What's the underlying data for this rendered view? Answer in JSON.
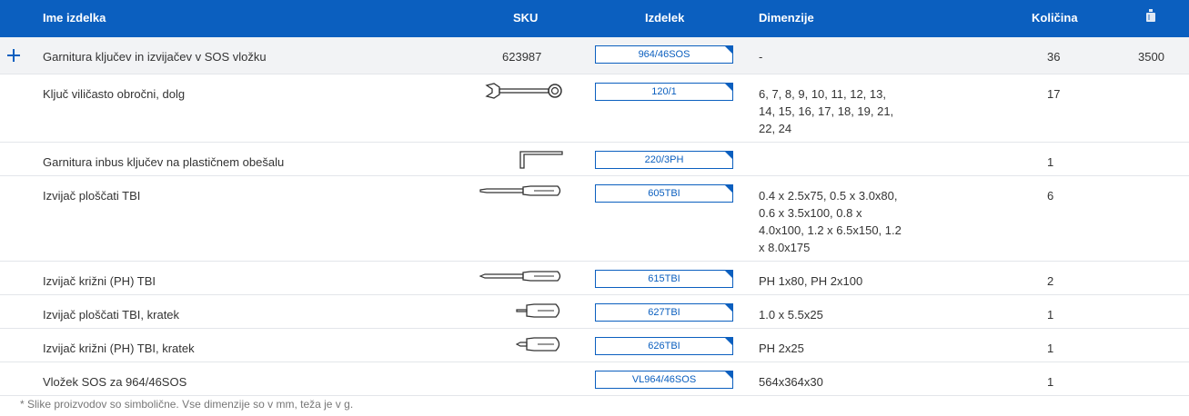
{
  "header": {
    "name": "Ime izdelka",
    "sku": "SKU",
    "product": "Izdelek",
    "dimensions": "Dimenzije",
    "quantity": "Količina",
    "weight_icon": "weight-icon"
  },
  "rows": [
    {
      "name": "Garnitura ključev in izvijačev v SOS vložku",
      "sku": "623987",
      "code": "964/46SOS",
      "dimensions": "-",
      "quantity": "36",
      "weight": "3500",
      "tool_icon": ""
    },
    {
      "name": "Ključ viličasto obročni, dolg",
      "sku": "",
      "code": "120/1",
      "dimensions": "6, 7, 8, 9, 10, 11, 12, 13, 14, 15, 16, 17, 18, 19, 21, 22, 24",
      "quantity": "17",
      "weight": "",
      "tool_icon": "combination-wrench-icon"
    },
    {
      "name": "Garnitura inbus ključev na plastičnem obešalu",
      "sku": "",
      "code": "220/3PH",
      "dimensions": "",
      "quantity": "1",
      "weight": "",
      "tool_icon": "hex-key-icon"
    },
    {
      "name": "Izvijač ploščati TBI",
      "sku": "",
      "code": "605TBI",
      "dimensions": "0.4 x 2.5x75, 0.5 x 3.0x80, 0.6 x 3.5x100, 0.8 x 4.0x100, 1.2 x 6.5x150, 1.2 x 8.0x175",
      "quantity": "6",
      "weight": "",
      "tool_icon": "flat-screwdriver-icon"
    },
    {
      "name": "Izvijač križni (PH) TBI",
      "sku": "",
      "code": "615TBI",
      "dimensions": "PH 1x80, PH 2x100",
      "quantity": "2",
      "weight": "",
      "tool_icon": "phillips-screwdriver-icon"
    },
    {
      "name": "Izvijač ploščati TBI, kratek",
      "sku": "",
      "code": "627TBI",
      "dimensions": "1.0 x 5.5x25",
      "quantity": "1",
      "weight": "",
      "tool_icon": "stubby-flat-screwdriver-icon"
    },
    {
      "name": "Izvijač križni (PH) TBI, kratek",
      "sku": "",
      "code": "626TBI",
      "dimensions": "PH 2x25",
      "quantity": "1",
      "weight": "",
      "tool_icon": "stubby-phillips-screwdriver-icon"
    },
    {
      "name": "Vložek SOS za 964/46SOS",
      "sku": "",
      "code": "VL964/46SOS",
      "dimensions": "564x364x30",
      "quantity": "1",
      "weight": "",
      "tool_icon": ""
    }
  ],
  "footnote": "* Slike proizvodov so simbolične. Vse dimenzije so v mm, teža je v g.",
  "colors": {
    "accent": "#0b5fbf",
    "row_highlight": "#f2f3f5"
  }
}
